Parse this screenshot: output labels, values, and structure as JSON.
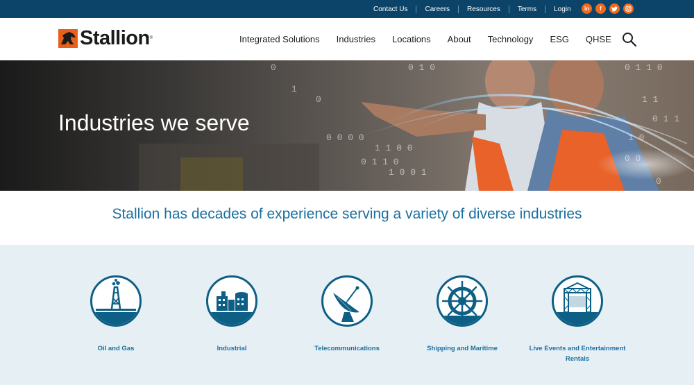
{
  "topbar": {
    "links": [
      "Contact Us",
      "Careers",
      "Resources",
      "Terms",
      "Login"
    ],
    "social": [
      "in",
      "f",
      "t",
      "ig"
    ]
  },
  "header": {
    "logo_text": "Stallion",
    "nav": [
      "Integrated Solutions",
      "Industries",
      "Locations",
      "About",
      "Technology",
      "ESG",
      "QHSE"
    ]
  },
  "hero": {
    "title": "Industries we serve"
  },
  "intro": {
    "text": "Stallion has decades of experience serving a variety of diverse industries"
  },
  "industries": [
    {
      "label": "Oil and Gas",
      "icon": "oil-rig-icon"
    },
    {
      "label": "Industrial",
      "icon": "factory-icon"
    },
    {
      "label": "Telecommunications",
      "icon": "satellite-dish-icon"
    },
    {
      "label": "Shipping and Maritime",
      "icon": "ship-wheel-icon"
    },
    {
      "label": "Live Events and Entertainment Rentals",
      "icon": "stage-truss-icon"
    }
  ],
  "colors": {
    "topbar": "#0b4468",
    "accent": "#ef6a1d",
    "brand_blue": "#1b6fa0",
    "section_bg": "#e6eff4"
  }
}
